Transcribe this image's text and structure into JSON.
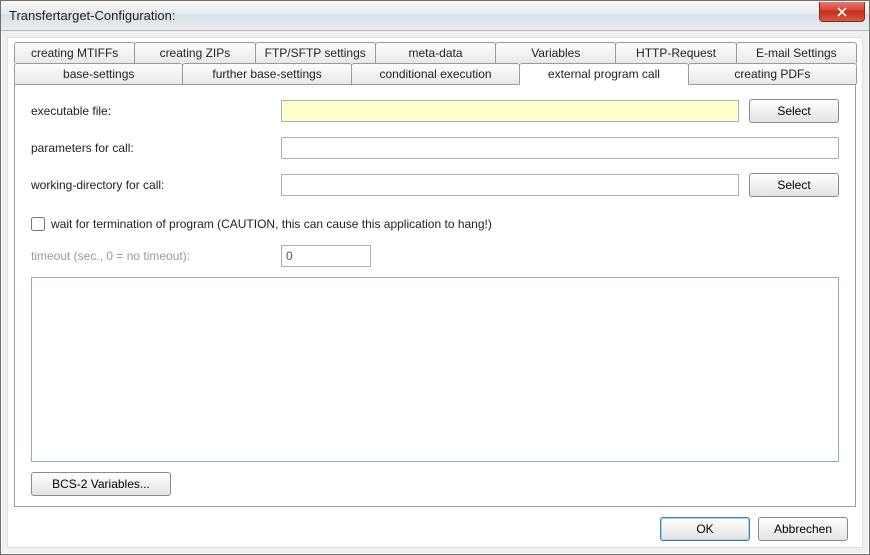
{
  "window": {
    "title": "Transfertarget-Configuration:"
  },
  "tabs_row1": [
    "creating MTIFFs",
    "creating ZIPs",
    "FTP/SFTP settings",
    "meta-data",
    "Variables",
    "HTTP-Request",
    "E-mail Settings"
  ],
  "tabs_row2": [
    "base-settings",
    "further base-settings",
    "conditional execution",
    "external program call",
    "creating PDFs"
  ],
  "active_tab": "external program call",
  "form": {
    "executable_label": "executable file:",
    "executable_value": "",
    "select_button": "Select",
    "parameters_label": "parameters for call:",
    "parameters_value": "",
    "workdir_label": "working-directory for call:",
    "workdir_value": "",
    "wait_checkbox_label": "wait for termination of program (CAUTION, this can cause this application to hang!)",
    "wait_checked": false,
    "timeout_label": "timeout (sec., 0 = no timeout):",
    "timeout_value": "0",
    "bcs_button": "BCS-2 Variables..."
  },
  "footer": {
    "ok": "OK",
    "cancel": "Abbrechen"
  }
}
